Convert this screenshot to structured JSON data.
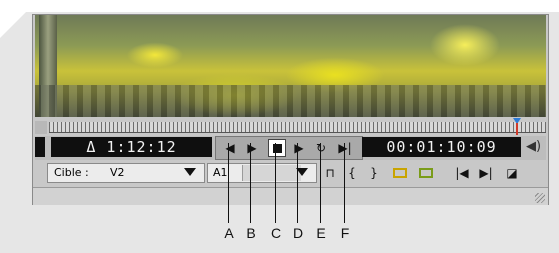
{
  "timecode": {
    "duration": "Δ 1:12:12",
    "current": "00:01:10:09"
  },
  "target": {
    "label": "Cible :",
    "video_track": "V2",
    "audio_track": "A1"
  },
  "icons": {
    "step_back": "◀",
    "step_forward": "▶",
    "play": "▶",
    "loop": "↻",
    "play_to_out": "▶|",
    "volume": "◀)",
    "mark_in": "{",
    "mark_out": "}",
    "lift": "⊓",
    "goto_prev": "|◀",
    "goto_next": "▶|",
    "export_frame": "◪"
  },
  "callouts": [
    "A",
    "B",
    "C",
    "D",
    "E",
    "F"
  ],
  "colors": {
    "timecode_bg": "#0f0f0f",
    "playhead": "#2d7bd8",
    "in_out_marker": "#d03a2a"
  }
}
